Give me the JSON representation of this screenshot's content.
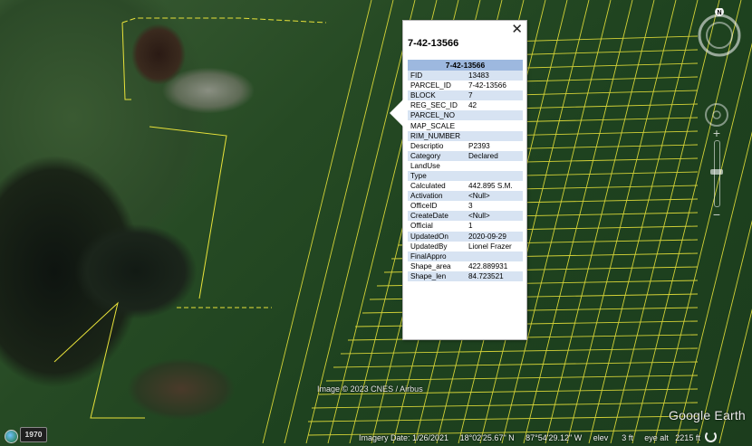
{
  "popup": {
    "close_glyph": "✕",
    "title": "7-42-13566",
    "table_header": "7-42-13566",
    "rows": [
      {
        "key": "FID",
        "value": "13483"
      },
      {
        "key": "PARCEL_ID",
        "value": "7-42-13566"
      },
      {
        "key": "BLOCK",
        "value": "7"
      },
      {
        "key": "REG_SEC_ID",
        "value": "42"
      },
      {
        "key": "PARCEL_NO",
        "value": ""
      },
      {
        "key": "MAP_SCALE",
        "value": ""
      },
      {
        "key": "RIM_NUMBER",
        "value": ""
      },
      {
        "key": "Descriptio",
        "value": "P2393"
      },
      {
        "key": "Category",
        "value": "Declared"
      },
      {
        "key": "LandUse",
        "value": ""
      },
      {
        "key": "Type",
        "value": ""
      },
      {
        "key": "Calculated",
        "value": "442.895 S.M."
      },
      {
        "key": "Activation",
        "value": "<Null>"
      },
      {
        "key": "OfficeID",
        "value": "3"
      },
      {
        "key": "CreateDate",
        "value": "<Null>"
      },
      {
        "key": "Official",
        "value": "1"
      },
      {
        "key": "UpdatedOn",
        "value": "2020-09-29"
      },
      {
        "key": "UpdatedBy",
        "value": "Lionel Frazer"
      },
      {
        "key": "FinalAppro",
        "value": ""
      },
      {
        "key": "Shape_area",
        "value": "422.889931"
      },
      {
        "key": "Shape_len",
        "value": "84.723521"
      }
    ]
  },
  "nav": {
    "compass_north": "N",
    "zoom_plus": "+",
    "zoom_minus": "−"
  },
  "attribution": "Image © 2023 CNES / Airbus",
  "logo": "Google Earth",
  "history": {
    "year": "1970"
  },
  "status": {
    "imagery_date": "Imagery Date: 1/26/2021",
    "latitude": "18°02'25.67\" N",
    "longitude": "87°54'29.12\" W",
    "elevation": "elev      3 ft",
    "eye_alt": "eye alt   2215 ft"
  },
  "colors": {
    "parcel_line": "#e8e23a",
    "table_header_bg": "#9db8df",
    "table_alt_row_bg": "#d7e3f2"
  }
}
